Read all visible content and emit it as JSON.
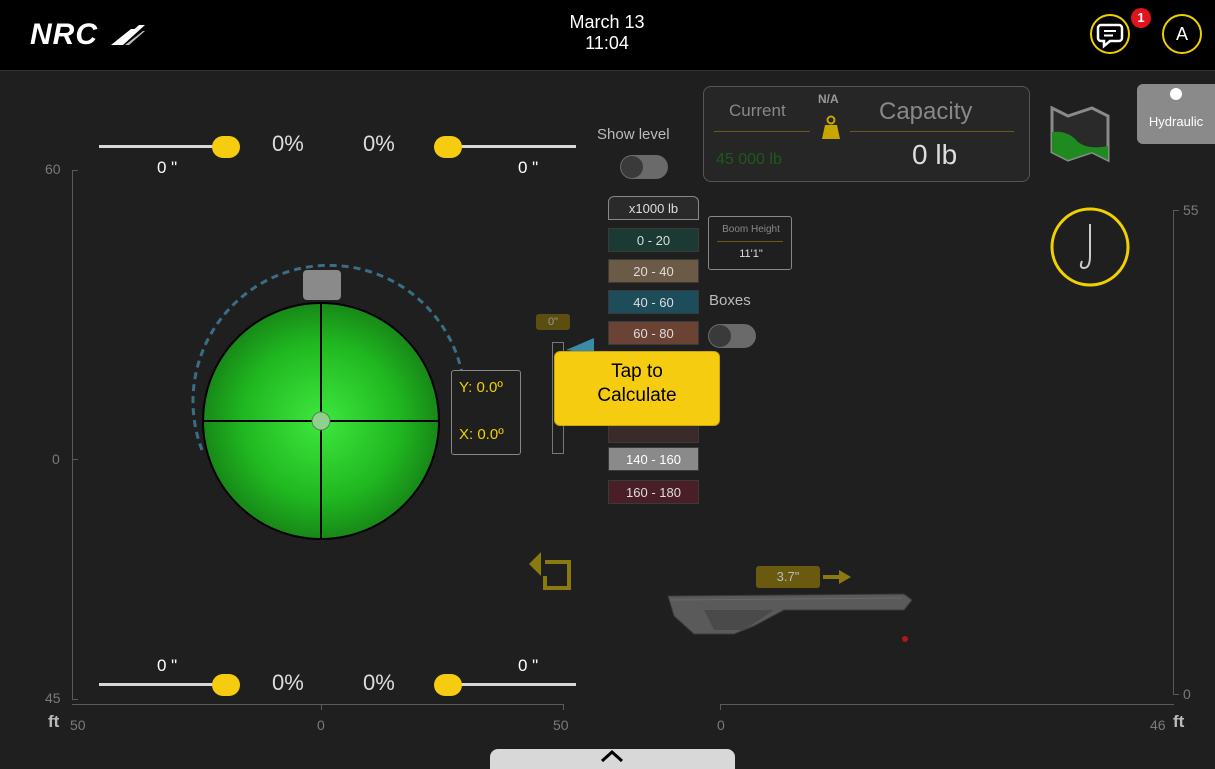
{
  "header": {
    "logo": "NRC",
    "date": "March 13",
    "time": "11:04",
    "chat_badge_count": "1",
    "avatar_initial": "A"
  },
  "sliders": {
    "top_left": {
      "inch": "0 \"",
      "pct": "0%"
    },
    "top_right": {
      "inch": "0 \"",
      "pct": "0%"
    },
    "bottom_left": {
      "inch": "0 \"",
      "pct": "0%"
    },
    "bottom_right": {
      "inch": "0 \"",
      "pct": "0%"
    }
  },
  "left_axis": {
    "y_top": "60",
    "y_mid": "0",
    "y_bottom": "45",
    "unit": "ft",
    "x_left": "50",
    "x_mid": "0",
    "x_right": "50"
  },
  "right_axis": {
    "y_top": "55",
    "y_bottom": "0",
    "x_left": "0",
    "x_right": "46",
    "unit": "ft"
  },
  "level": {
    "y_label": "Y: 0.0º",
    "x_label": "X: 0.0º"
  },
  "show_level": {
    "label": "Show level"
  },
  "capacity_panel": {
    "current_label": "Current",
    "current_value": "45 000 lb",
    "na_label": "N/A",
    "capacity_label": "Capacity",
    "capacity_value": "0 lb"
  },
  "legend": {
    "header": "x1000 lb",
    "items": [
      {
        "label": "0 - 20",
        "color": "#1b3a33"
      },
      {
        "label": "20 - 40",
        "color": "#6b5a45"
      },
      {
        "label": "40 - 60",
        "color": "#1d4c5a"
      },
      {
        "label": "60 - 80",
        "color": "#6a4334"
      },
      {
        "label": "140 - 160",
        "color": "#8a8a8a"
      },
      {
        "label": "160 - 180",
        "color": "#4a1e26"
      }
    ]
  },
  "boom_height": {
    "label": "Boom Height",
    "value": "11'1\""
  },
  "boxes": {
    "label": "Boxes"
  },
  "tap_button": {
    "line1": "Tap to",
    "line2": "Calculate"
  },
  "indicator_tag": "0\"",
  "boom_length_tag": "3.7\"",
  "hydraulic": {
    "label": "Hydraulic"
  },
  "colors": {
    "accent": "#f5cc10",
    "badge": "#e0141c",
    "level_green": "#22c322"
  }
}
